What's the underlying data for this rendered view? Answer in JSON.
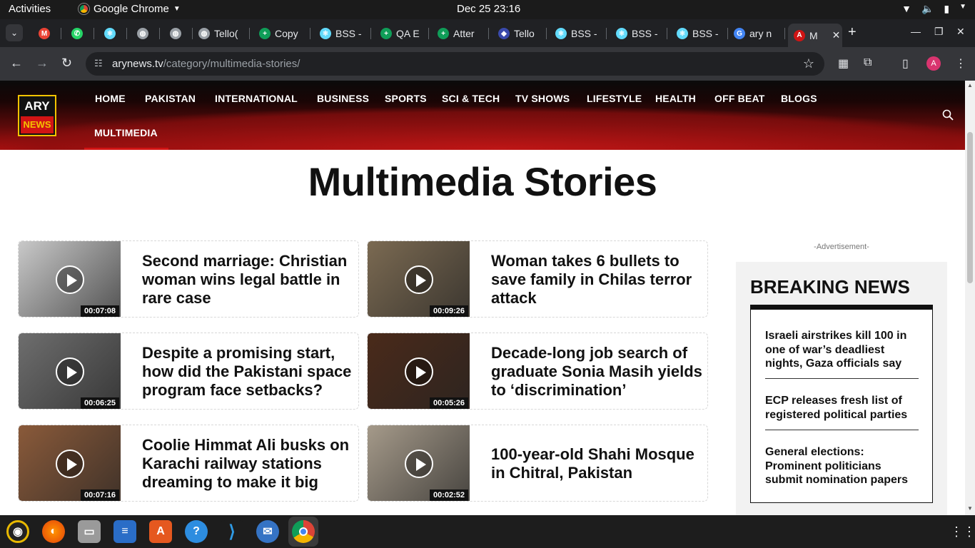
{
  "os_bar": {
    "activities": "Activities",
    "app_name": "Google Chrome",
    "clock": "Dec 25  23:16"
  },
  "tabs": [
    {
      "label": "",
      "icon": "gmail-icon",
      "color": "#ea4335"
    },
    {
      "label": "",
      "icon": "whatsapp-icon",
      "color": "#25d366"
    },
    {
      "label": "",
      "icon": "react-icon",
      "color": "#61dafb"
    },
    {
      "label": "",
      "icon": "globe-icon",
      "color": "#9aa0a6"
    },
    {
      "label": "",
      "icon": "globe-icon",
      "color": "#9aa0a6"
    },
    {
      "label": "Tello(",
      "icon": "globe-icon",
      "color": "#9aa0a6"
    },
    {
      "label": "Copy",
      "icon": "sheets-icon",
      "color": "#0f9d58"
    },
    {
      "label": "BSS -",
      "icon": "react-icon",
      "color": "#61dafb"
    },
    {
      "label": "QA E",
      "icon": "sheets-icon",
      "color": "#0f9d58"
    },
    {
      "label": "Atter",
      "icon": "sheets-icon",
      "color": "#0f9d58"
    },
    {
      "label": "Tello",
      "icon": "shield-icon",
      "color": "#3949ab"
    },
    {
      "label": "BSS -",
      "icon": "react-icon",
      "color": "#61dafb"
    },
    {
      "label": "BSS -",
      "icon": "react-icon",
      "color": "#61dafb"
    },
    {
      "label": "BSS -",
      "icon": "react-icon",
      "color": "#61dafb"
    },
    {
      "label": "ary n",
      "icon": "google-icon",
      "color": "#4285f4"
    },
    {
      "label": "M",
      "icon": "ary-icon",
      "color": "#d11414"
    }
  ],
  "address": {
    "host": "arynews.tv",
    "path": "/category/multimedia-stories/"
  },
  "avatar_letter": "A",
  "site": {
    "logo_top": "ARY",
    "logo_bottom": "NEWS",
    "nav": [
      "HOME",
      "PAKISTAN",
      "INTERNATIONAL",
      "BUSINESS",
      "SPORTS",
      "SCI & TECH",
      "TV SHOWS",
      "LIFESTYLE",
      "HEALTH",
      "OFF BEAT",
      "BLOGS",
      "MULTIMEDIA"
    ],
    "active_nav": "MULTIMEDIA",
    "accent": "#d11414"
  },
  "page_title": "Multimedia Stories",
  "stories": [
    {
      "title": "Second marriage: Christian woman wins legal battle in rare case",
      "duration": "00:07:08",
      "thumb_color": "#c9c9c9"
    },
    {
      "title": "Woman takes 6 bullets to save family in Chilas terror attack",
      "duration": "00:09:26",
      "thumb_color": "#7b6a52"
    },
    {
      "title": "Despite a promising start, how did the Pakistani space program face setbacks?",
      "duration": "00:06:25",
      "thumb_color": "#6e6e6e"
    },
    {
      "title": "Decade-long job search of graduate Sonia Masih yields to ‘discrimination’",
      "duration": "00:05:26",
      "thumb_color": "#4a2a1a"
    },
    {
      "title": "Coolie Himmat Ali busks on Karachi railway stations dreaming to make it big",
      "duration": "00:07:16",
      "thumb_color": "#8a5a3a"
    },
    {
      "title": "100-year-old Shahi Mosque in Chitral, Pakistan",
      "duration": "00:02:52",
      "thumb_color": "#a59a8a"
    }
  ],
  "sidebar": {
    "ad_label": "-Advertisement-",
    "heading": "BREAKING NEWS",
    "items": [
      "Israeli airstrikes kill 100 in one of war’s deadliest nights, Gaza officials say",
      "ECP releases fresh list of registered political parties",
      "General elections: Prominent politicians submit nomination papers"
    ]
  }
}
